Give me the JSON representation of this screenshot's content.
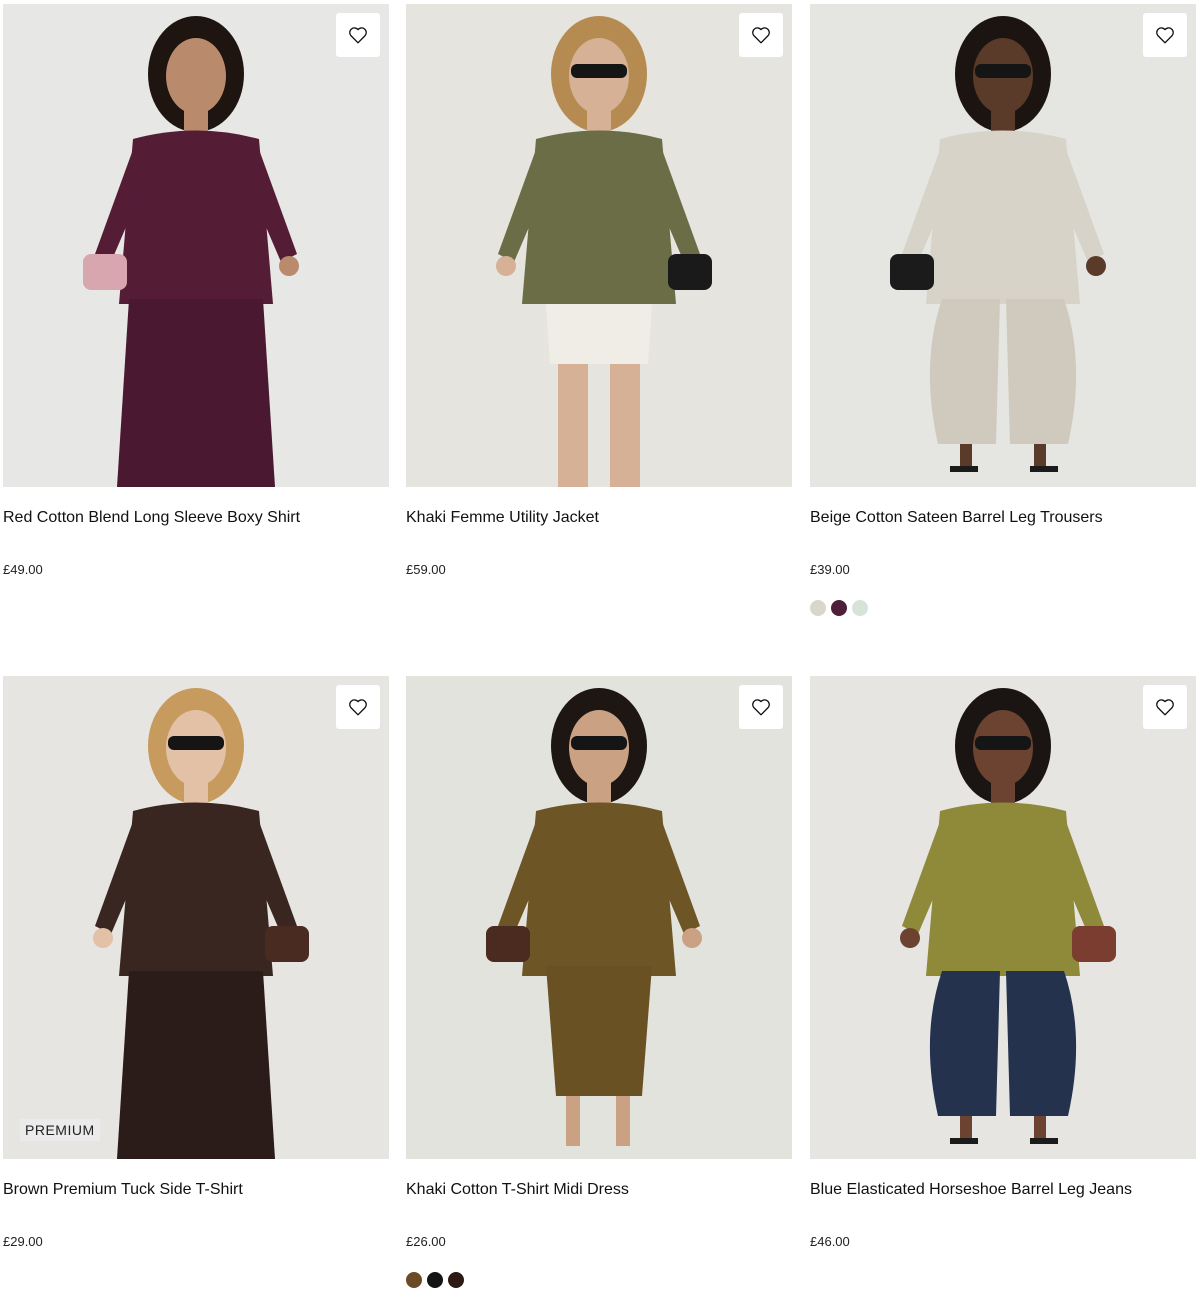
{
  "products": [
    {
      "title": "Red Cotton Blend Long Sleeve Boxy Shirt",
      "price": "£49.00",
      "badge": null,
      "swatches": [],
      "colors": {
        "bg": "#e7e7e5",
        "top": "#551c36",
        "bottom": "#4a1830",
        "skin": "#b98a6c",
        "hair": "#1e1510",
        "accent": "#d8a6ae"
      }
    },
    {
      "title": "Khaki Femme Utility Jacket",
      "price": "£59.00",
      "badge": null,
      "swatches": [],
      "colors": {
        "bg": "#e6e4df",
        "top": "#6a6d45",
        "bottom": "#efede6",
        "skin": "#d7b196",
        "hair": "#b58b52",
        "accent": "#1a1a1a"
      }
    },
    {
      "title": "Beige Cotton Sateen Barrel Leg Trousers",
      "price": "£39.00",
      "badge": null,
      "swatches": [
        "#d9d6cc",
        "#4e1f3a",
        "#d6e3d6"
      ],
      "colors": {
        "bg": "#e5e5e1",
        "top": "#d7d3c8",
        "bottom": "#cfcabd",
        "skin": "#5a3a29",
        "hair": "#1b1411",
        "accent": "#1b1b1b"
      }
    },
    {
      "title": "Brown Premium Tuck Side T-Shirt",
      "price": "£29.00",
      "badge": "PREMIUM",
      "swatches": [],
      "colors": {
        "bg": "#e6e5e2",
        "top": "#3a2621",
        "bottom": "#2c1c19",
        "skin": "#e2c1a7",
        "hair": "#c79a5d",
        "accent": "#4a2b22"
      }
    },
    {
      "title": "Khaki Cotton T-Shirt Midi Dress",
      "price": "£26.00",
      "badge": null,
      "swatches": [
        "#6b4a26",
        "#141414",
        "#2e1a14"
      ],
      "colors": {
        "bg": "#e3e3de",
        "top": "#6e5525",
        "bottom": "#6a5124",
        "skin": "#caa183",
        "hair": "#1d1612",
        "accent": "#4b2a1f"
      }
    },
    {
      "title": "Blue Elasticated Horseshoe Barrel Leg Jeans",
      "price": "£46.00",
      "badge": null,
      "swatches": [],
      "colors": {
        "bg": "#e6e5e1",
        "top": "#8f893a",
        "bottom": "#24324d",
        "skin": "#6b4330",
        "hair": "#1a1512",
        "accent": "#7a3d30"
      }
    }
  ],
  "icons": {
    "wishlist": "heart-outline-icon"
  }
}
